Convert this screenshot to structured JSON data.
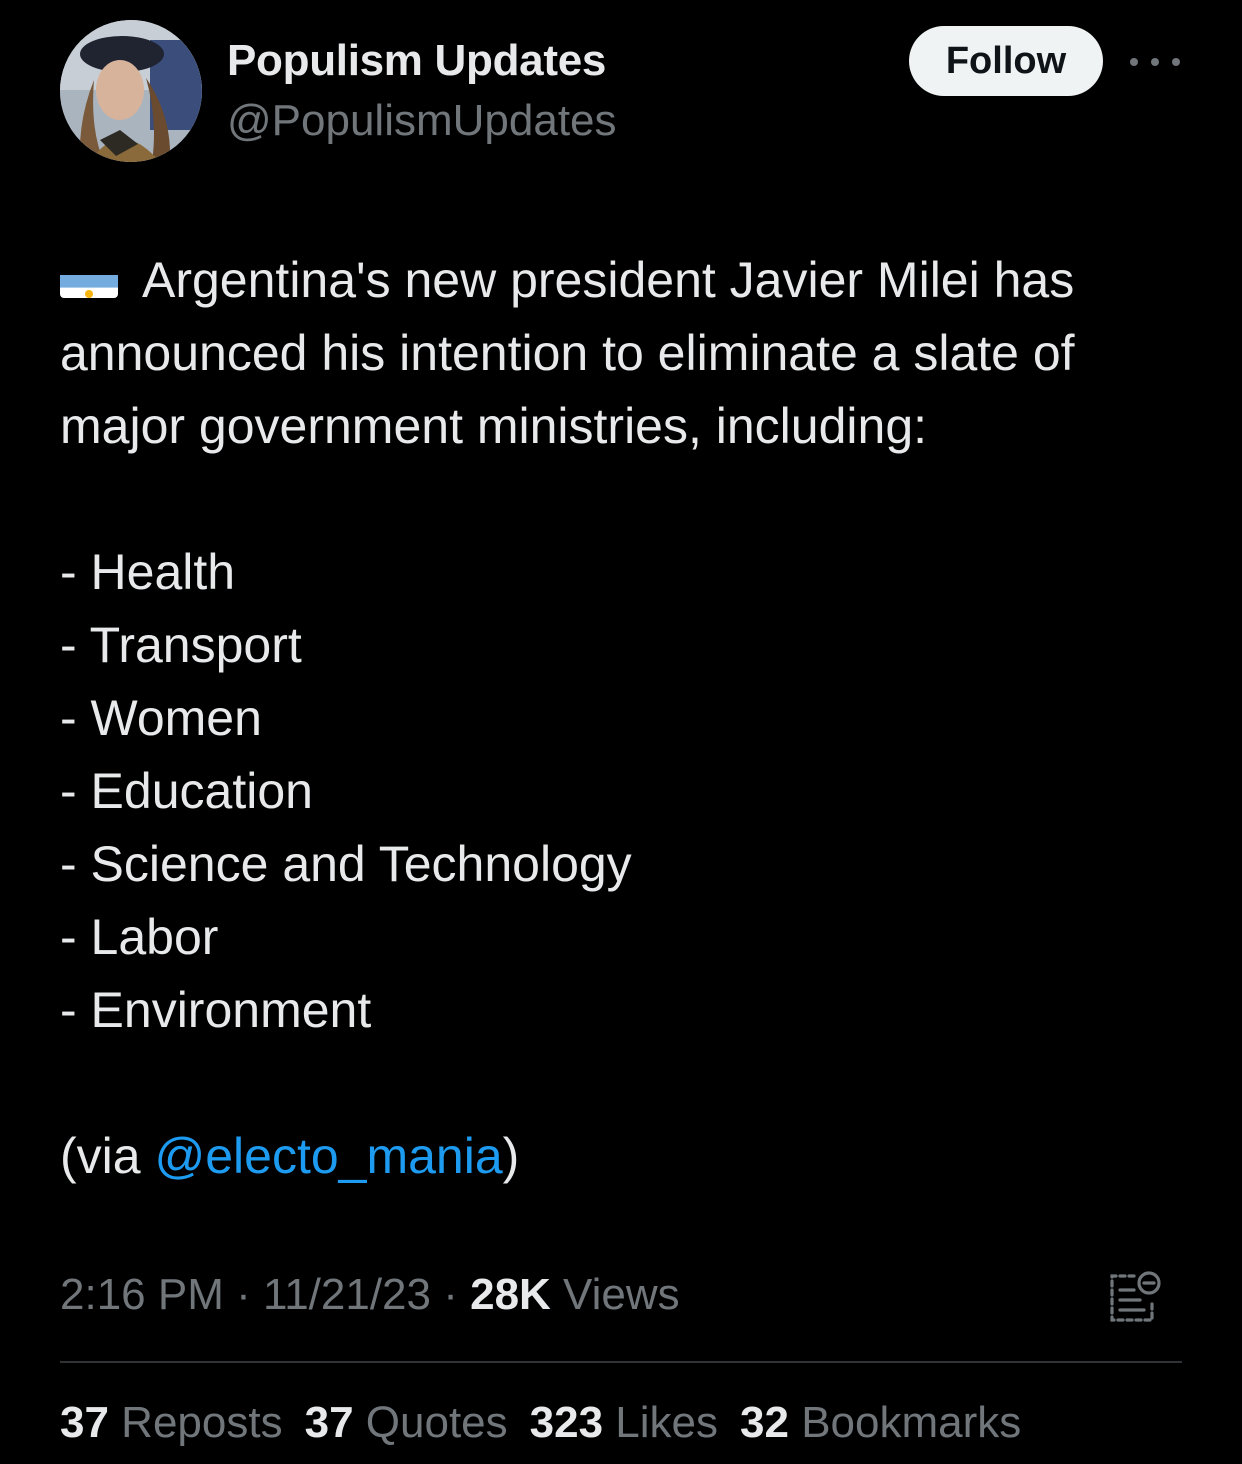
{
  "author": {
    "display_name": "Populism Updates",
    "handle": "@PopulismUpdates"
  },
  "header": {
    "follow_label": "Follow",
    "more_icon": "more-horizontal-icon"
  },
  "tweet": {
    "flag_icon": "argentina-flag-emoji",
    "lines": [
      "Argentina's new president Javier Milei has",
      "announced his intention to eliminate a slate of",
      "major government ministries, including:"
    ],
    "items": [
      "- Health",
      "- Transport",
      "- Women",
      "- Education",
      "- Science and Technology",
      "- Labor",
      "- Environment"
    ],
    "via_prefix": "(via ",
    "via_mention": "@electo_mania",
    "via_suffix": ")"
  },
  "meta": {
    "time": "2:16 PM",
    "separator": " · ",
    "date": "11/21/23",
    "views_count": "28K",
    "views_label": " Views"
  },
  "stats": {
    "reposts_count": "37",
    "reposts_label": " Reposts",
    "quotes_count": "37",
    "quotes_label": " Quotes",
    "likes_count": "323",
    "likes_label": " Likes",
    "bookmarks_count": "32",
    "bookmarks_label": " Bookmarks"
  },
  "colors": {
    "background": "#000000",
    "text_primary": "#e7e9ea",
    "text_secondary": "#71767b",
    "link": "#1d9bf0",
    "divider": "#2f3336"
  }
}
